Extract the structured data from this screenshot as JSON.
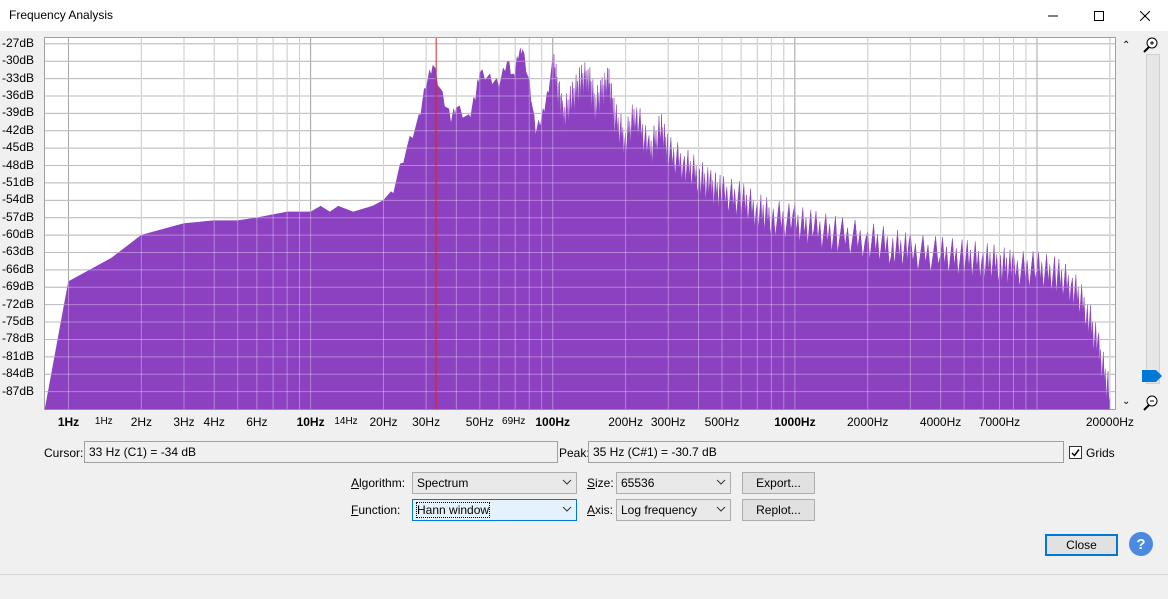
{
  "window": {
    "title": "Frequency Analysis"
  },
  "colors": {
    "spectrum_fill": "#8b41c0",
    "cursor_line": "#e02020",
    "accent": "#0078d7"
  },
  "chart_data": {
    "type": "area",
    "x_scale": "log",
    "y_tick_labels": [
      "-27dB",
      "-30dB",
      "-33dB",
      "-36dB",
      "-39dB",
      "-42dB",
      "-45dB",
      "-48dB",
      "-51dB",
      "-54dB",
      "-57dB",
      "-60dB",
      "-63dB",
      "-66dB",
      "-69dB",
      "-72dB",
      "-75dB",
      "-78dB",
      "-81dB",
      "-84dB",
      "-87dB"
    ],
    "x_tick_labels": [
      {
        "label": "1Hz",
        "bold": true,
        "small": false
      },
      {
        "label": "1Hz",
        "bold": false,
        "small": true
      },
      {
        "label": "2Hz",
        "bold": false,
        "small": false
      },
      {
        "label": "3Hz",
        "bold": false,
        "small": false
      },
      {
        "label": "4Hz",
        "bold": false,
        "small": false
      },
      {
        "label": "6Hz",
        "bold": false,
        "small": false
      },
      {
        "label": "10Hz",
        "bold": true,
        "small": false
      },
      {
        "label": "14Hz",
        "bold": false,
        "small": true
      },
      {
        "label": "20Hz",
        "bold": false,
        "small": false
      },
      {
        "label": "30Hz",
        "bold": false,
        "small": false
      },
      {
        "label": "50Hz",
        "bold": false,
        "small": false
      },
      {
        "label": "69Hz",
        "bold": false,
        "small": true
      },
      {
        "label": "100Hz",
        "bold": true,
        "small": false
      },
      {
        "label": "200Hz",
        "bold": false,
        "small": false
      },
      {
        "label": "300Hz",
        "bold": false,
        "small": false
      },
      {
        "label": "500Hz",
        "bold": false,
        "small": false
      },
      {
        "label": "1000Hz",
        "bold": true,
        "small": false
      },
      {
        "label": "2000Hz",
        "bold": false,
        "small": false
      },
      {
        "label": "4000Hz",
        "bold": false,
        "small": false
      },
      {
        "label": "7000Hz",
        "bold": false,
        "small": false
      },
      {
        "label": "20000Hz",
        "bold": false,
        "small": false
      }
    ],
    "ylim": [
      -90,
      -26
    ],
    "grid": true,
    "cursor_hz": 33,
    "x": [
      1,
      1.5,
      2,
      3,
      4,
      5,
      6,
      8,
      10,
      11,
      12,
      13,
      15,
      18,
      20,
      22,
      25,
      28,
      30,
      32,
      35,
      38,
      40,
      45,
      48,
      50,
      55,
      60,
      65,
      69,
      72,
      75,
      80,
      85,
      90,
      95,
      100,
      105,
      110,
      120,
      130,
      140,
      150,
      160,
      170,
      180,
      200,
      220,
      250,
      280,
      300,
      350,
      400,
      450,
      500,
      600,
      700,
      800,
      1000,
      1200,
      1500,
      2000,
      2500,
      3000,
      4000,
      5000,
      6000,
      7000,
      8000,
      10000,
      12000,
      14000,
      16000,
      18000,
      20000
    ],
    "y": [
      -68,
      -64,
      -60,
      -58,
      -57.5,
      -57.5,
      -57,
      -56,
      -56,
      -55,
      -56,
      -55,
      -56,
      -55,
      -54,
      -52,
      -45,
      -40,
      -34,
      -30.7,
      -36,
      -40,
      -38,
      -40,
      -36,
      -32,
      -33,
      -34,
      -30,
      -33,
      -29,
      -28,
      -34,
      -42,
      -40,
      -36,
      -31,
      -35,
      -40,
      -37,
      -34,
      -33,
      -38,
      -36,
      -34,
      -40,
      -44,
      -39,
      -46,
      -42,
      -46,
      -48,
      -50,
      -52,
      -53,
      -54,
      -56,
      -57,
      -58,
      -59,
      -60,
      -61,
      -62,
      -63,
      -63.5,
      -64,
      -64.5,
      -65,
      -66,
      -66,
      -67,
      -69,
      -73,
      -80,
      -88
    ]
  },
  "cursor": {
    "label": "Cursor:",
    "value": "33 Hz (C1) = -34 dB"
  },
  "peak": {
    "label": "Peak:",
    "value": "35 Hz (C#1) = -30.7 dB"
  },
  "grids": {
    "label": "Grids",
    "checked": true
  },
  "algorithm": {
    "label": "Algorithm:",
    "value": "Spectrum"
  },
  "size": {
    "label": "Size:",
    "value": "65536"
  },
  "function": {
    "label": "Function:",
    "value": "Hann window"
  },
  "axis": {
    "label": "Axis:",
    "value": "Log frequency"
  },
  "buttons": {
    "export": "Export...",
    "replot": "Replot...",
    "close": "Close",
    "help": "?"
  }
}
